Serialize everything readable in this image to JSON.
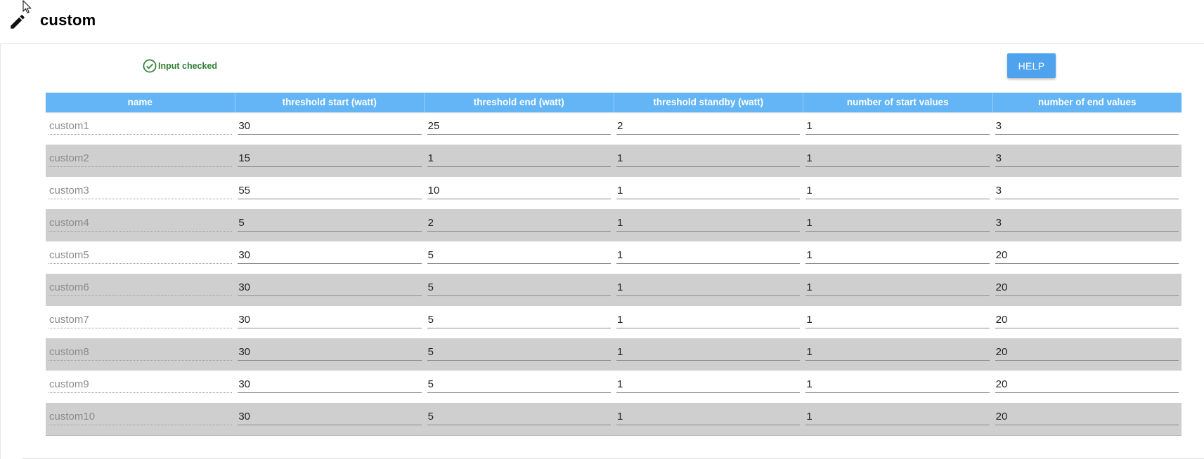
{
  "header": {
    "title": "custom",
    "icon": "pencil-icon"
  },
  "status": {
    "text": "Input checked",
    "color": "#2e7d32",
    "icon": "check-circle-icon"
  },
  "help_button": {
    "label": "HELP",
    "color": "#4fa3ee"
  },
  "table": {
    "header_color": "#64b5f6",
    "columns": [
      "name",
      "threshold start (watt)",
      "threshold end (watt)",
      "threshold standby (watt)",
      "number of start values",
      "number of end values"
    ],
    "rows": [
      [
        "custom1",
        "30",
        "25",
        "2",
        "1",
        "3"
      ],
      [
        "custom2",
        "15",
        "1",
        "1",
        "1",
        "3"
      ],
      [
        "custom3",
        "55",
        "10",
        "1",
        "1",
        "3"
      ],
      [
        "custom4",
        "5",
        "2",
        "1",
        "1",
        "3"
      ],
      [
        "custom5",
        "30",
        "5",
        "1",
        "1",
        "20"
      ],
      [
        "custom6",
        "30",
        "5",
        "1",
        "1",
        "20"
      ],
      [
        "custom7",
        "30",
        "5",
        "1",
        "1",
        "20"
      ],
      [
        "custom8",
        "30",
        "5",
        "1",
        "1",
        "20"
      ],
      [
        "custom9",
        "30",
        "5",
        "1",
        "1",
        "20"
      ],
      [
        "custom10",
        "30",
        "5",
        "1",
        "1",
        "20"
      ]
    ]
  }
}
